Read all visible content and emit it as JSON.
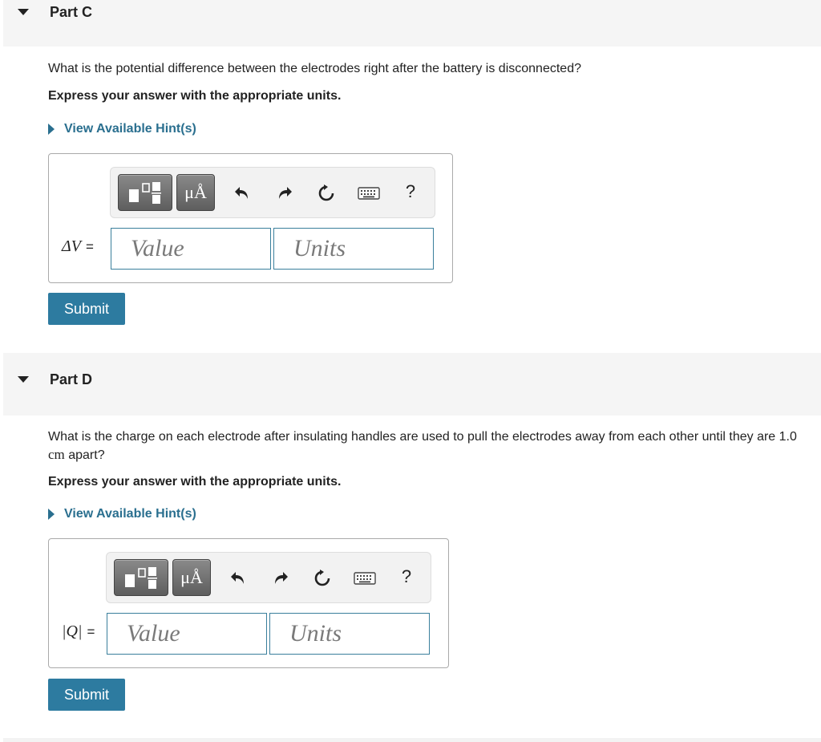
{
  "part_c": {
    "title": "Part C",
    "question": "What is the potential difference between the electrodes right after the battery is disconnected?",
    "instruction": "Express your answer with the appropriate units.",
    "hint_label": "View Available Hint(s)",
    "toolbar": {
      "templates_icon": "templates-icon",
      "units_label": "μÅ",
      "undo_icon": "undo-icon",
      "redo_icon": "redo-icon",
      "reset_icon": "reset-icon",
      "keyboard_icon": "keyboard-icon",
      "help_label": "?"
    },
    "variable_label": "ΔV",
    "equals": "=",
    "value_placeholder": "Value",
    "units_placeholder": "Units",
    "submit_label": "Submit"
  },
  "part_d": {
    "title": "Part D",
    "question_prefix": "What is the charge on each electrode after insulating handles are used to pull the electrodes away from each other until they are 1.0 ",
    "question_unit": "cm",
    "question_suffix": " apart?",
    "instruction": "Express your answer with the appropriate units.",
    "hint_label": "View Available Hint(s)",
    "toolbar": {
      "templates_icon": "templates-icon",
      "units_label": "μÅ",
      "undo_icon": "undo-icon",
      "redo_icon": "redo-icon",
      "reset_icon": "reset-icon",
      "keyboard_icon": "keyboard-icon",
      "help_label": "?"
    },
    "variable_label": "|Q|",
    "equals": "=",
    "value_placeholder": "Value",
    "units_placeholder": "Units",
    "submit_label": "Submit"
  },
  "colors": {
    "accent": "#2d7ba0",
    "link": "#2a6f8f",
    "field_border": "#3a7f9c",
    "header_bg": "#f5f5f5"
  }
}
